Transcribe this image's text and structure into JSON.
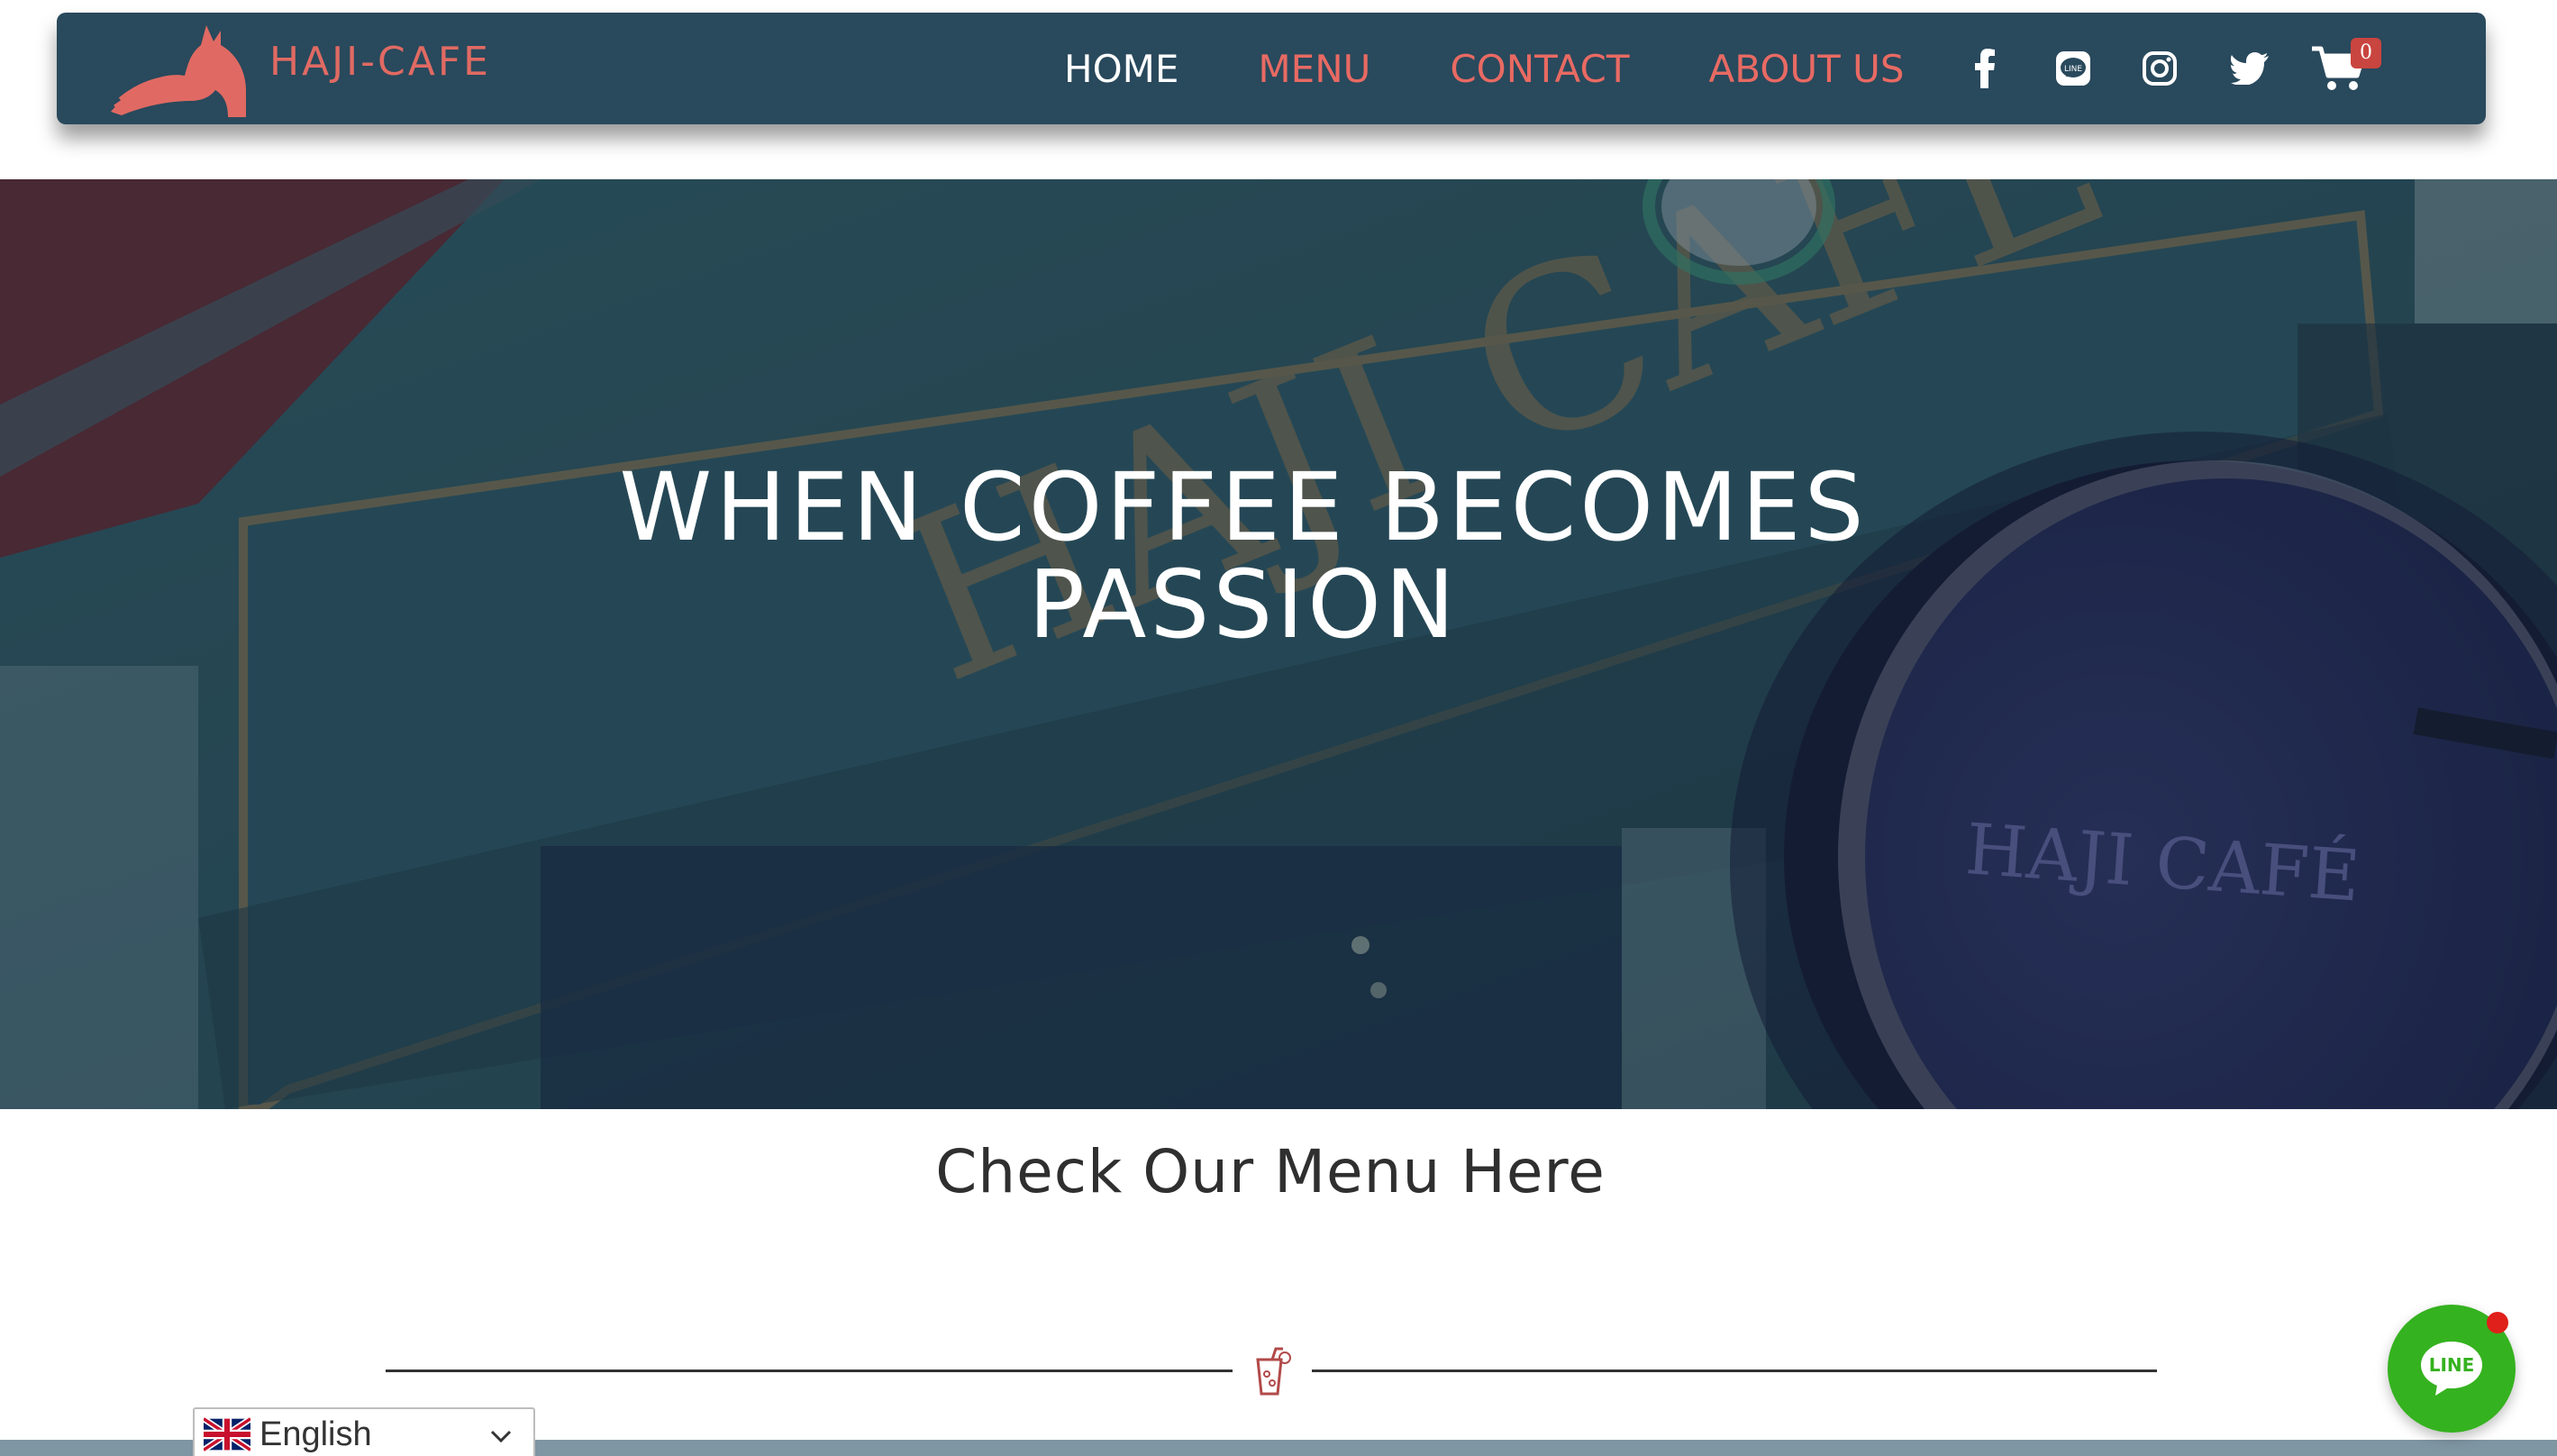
{
  "header": {
    "logo_text": "HAJI-CAFE",
    "nav": [
      {
        "label": "HOME"
      },
      {
        "label": "MENU"
      },
      {
        "label": "CONTACT"
      },
      {
        "label": "ABOUT US"
      }
    ],
    "social_icons": [
      "facebook-icon",
      "line-icon",
      "instagram-icon",
      "twitter-icon"
    ],
    "cart": {
      "icon": "cart-icon",
      "count": "0"
    }
  },
  "hero": {
    "title": "WHEN COFFEE BECOMES\nPASSION",
    "signage_text_1": "HAJI CAFE",
    "signage_text_2": "HAJI CAFÉ"
  },
  "menu_section": {
    "title": "Check Our Menu Here",
    "divider_icon": "drink-icon"
  },
  "language_selector": {
    "flag_icon": "uk-flag-icon",
    "selected": "English"
  },
  "line_chat": {
    "label": "LINE"
  },
  "colors": {
    "header_bg": "#29495c",
    "accent": "#e86a63",
    "line_green": "#35b21f"
  }
}
